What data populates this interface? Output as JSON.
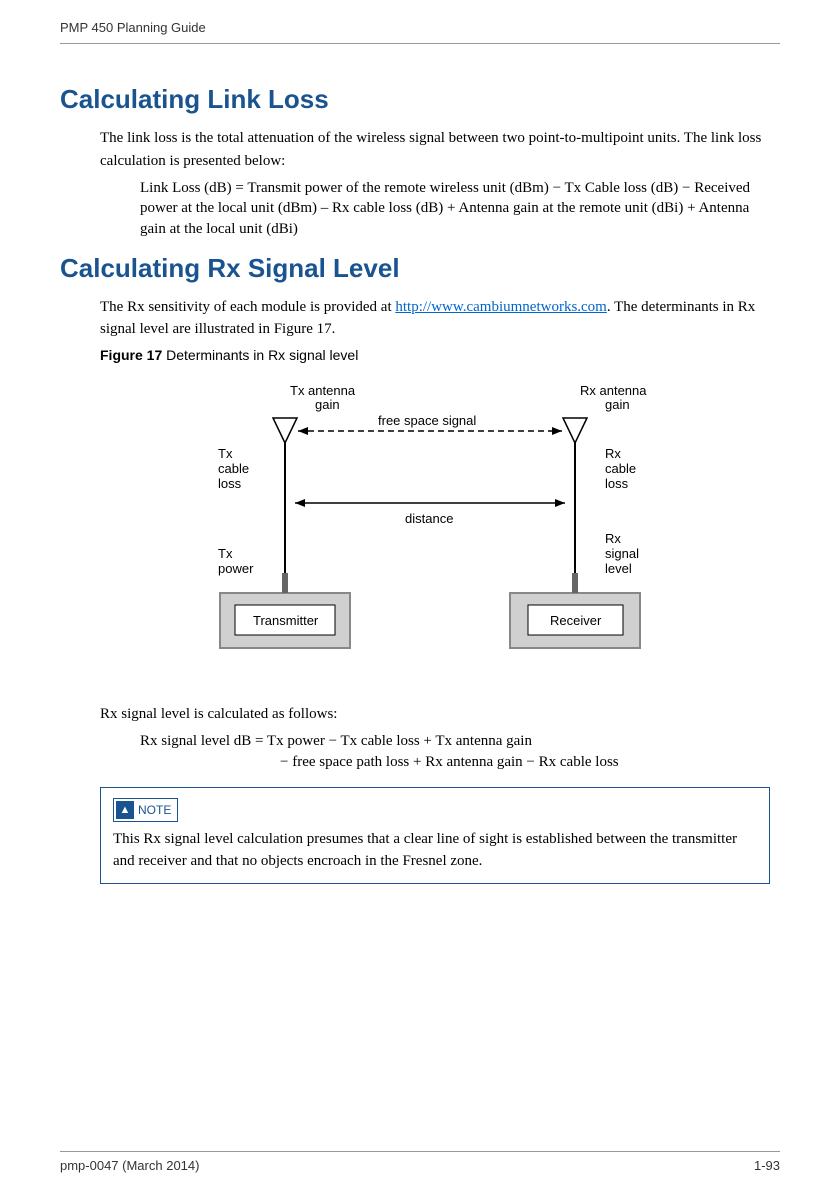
{
  "header": {
    "title": "PMP 450 Planning Guide"
  },
  "section1": {
    "heading": "Calculating Link Loss",
    "para1": "The link loss is the total attenuation of the wireless signal between two point-to-multipoint units. The link loss calculation is presented below:",
    "formula": "Link Loss (dB)   =  Transmit power of the remote wireless unit (dBm)  −  Tx Cable loss (dB) − Received power at the local unit (dBm) – Rx cable loss (dB) + Antenna gain at the remote unit (dBi) + Antenna gain at the local unit (dBi)"
  },
  "section2": {
    "heading": "Calculating Rx Signal Level",
    "para1_pre": "The Rx sensitivity of each module is provided at ",
    "para1_link": "http://www.cambiumnetworks.com",
    "para1_post": ". The determinants in Rx signal level are illustrated in Figure 17.",
    "figure_label": "Figure 17",
    "figure_caption": " Determinants in Rx signal level",
    "para2": "Rx signal level is calculated as follows:",
    "formula_line1": "Rx signal level  dB   =  Tx power  −  Tx cable loss  +  Tx antenna gain",
    "formula_line2": "−  free space path loss  +  Rx antenna gain  −  Rx cable loss"
  },
  "diagram": {
    "tx_antenna": "Tx antenna gain",
    "rx_antenna": "Rx antenna gain",
    "free_space": "free space signal",
    "tx_cable": "Tx cable loss",
    "rx_cable": "Rx cable loss",
    "distance": "distance",
    "tx_power": "Tx power",
    "rx_signal": "Rx signal level",
    "transmitter": "Transmitter",
    "receiver": "Receiver"
  },
  "note": {
    "badge": "NOTE",
    "text": "This Rx signal level calculation presumes that a clear line of sight is established between the transmitter and receiver and that no objects encroach in the Fresnel zone."
  },
  "footer": {
    "left": "pmp-0047 (March 2014)",
    "right": "1-93"
  }
}
